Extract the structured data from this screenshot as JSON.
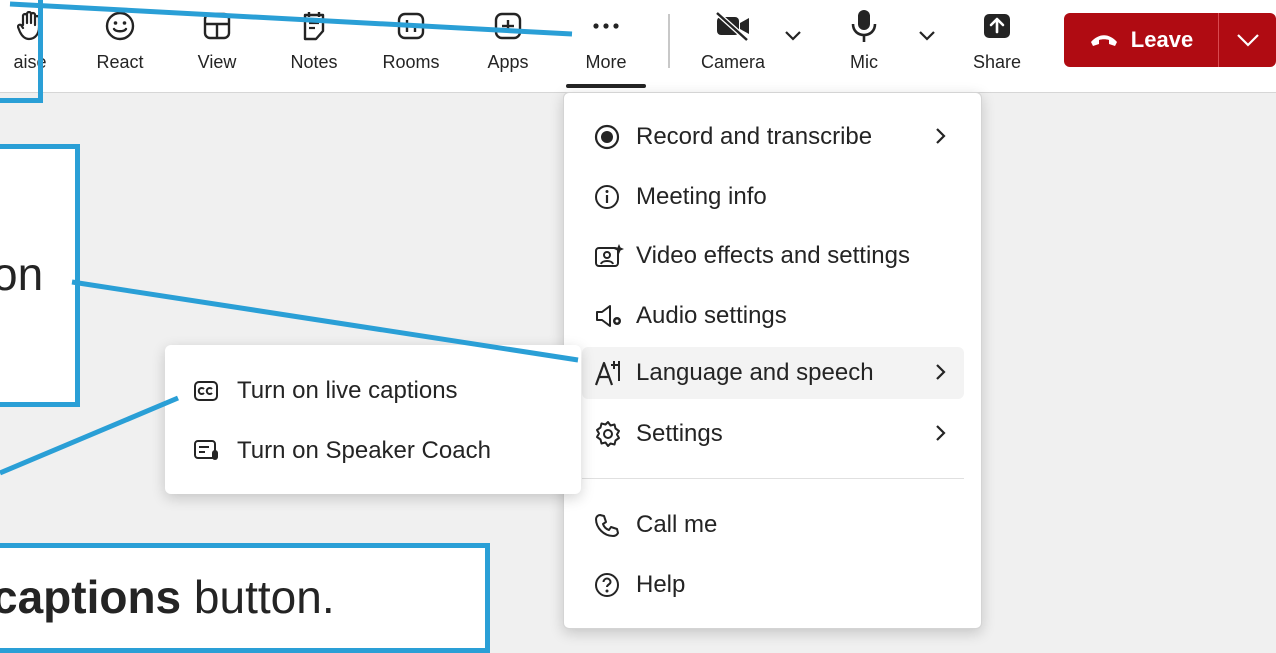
{
  "toolbar": {
    "buttons": [
      {
        "label": "aise",
        "icon": "raise-hand-icon"
      },
      {
        "label": "React",
        "icon": "smiley-icon"
      },
      {
        "label": "View",
        "icon": "grid-view-icon"
      },
      {
        "label": "Notes",
        "icon": "notes-icon"
      },
      {
        "label": "Rooms",
        "icon": "rooms-icon"
      },
      {
        "label": "Apps",
        "icon": "plus-square-icon"
      },
      {
        "label": "More",
        "icon": "ellipsis-icon"
      },
      {
        "label": "Camera",
        "icon": "camera-off-icon"
      },
      {
        "label": "Mic",
        "icon": "microphone-icon"
      },
      {
        "label": "Share",
        "icon": "share-arrow-icon"
      }
    ],
    "leave_label": "Leave"
  },
  "more_menu": {
    "items": [
      {
        "label": "Record and transcribe",
        "icon": "record-icon",
        "has_submenu": true
      },
      {
        "label": "Meeting info",
        "icon": "info-icon",
        "has_submenu": false
      },
      {
        "label": "Video effects and settings",
        "icon": "video-effects-icon",
        "has_submenu": false
      },
      {
        "label": "Audio settings",
        "icon": "audio-settings-icon",
        "has_submenu": false
      },
      {
        "label": "Language and speech",
        "icon": "language-icon",
        "has_submenu": true
      },
      {
        "label": "Settings",
        "icon": "gear-icon",
        "has_submenu": true
      },
      {
        "label": "Call me",
        "icon": "phone-icon",
        "has_submenu": false
      },
      {
        "label": "Help",
        "icon": "help-icon",
        "has_submenu": false
      }
    ]
  },
  "language_submenu": {
    "items": [
      {
        "label": "Turn on live captions",
        "icon": "captions-icon"
      },
      {
        "label": "Turn on Speaker Coach",
        "icon": "speaker-coach-icon"
      }
    ]
  },
  "annotations": {
    "middle_fragment": "on",
    "bottom_bold": "captions",
    "bottom_rest": " button.",
    "color": "#2a9fd6"
  },
  "colors": {
    "leave_bg": "#b00b12",
    "callout_blue": "#2a9fd6"
  }
}
